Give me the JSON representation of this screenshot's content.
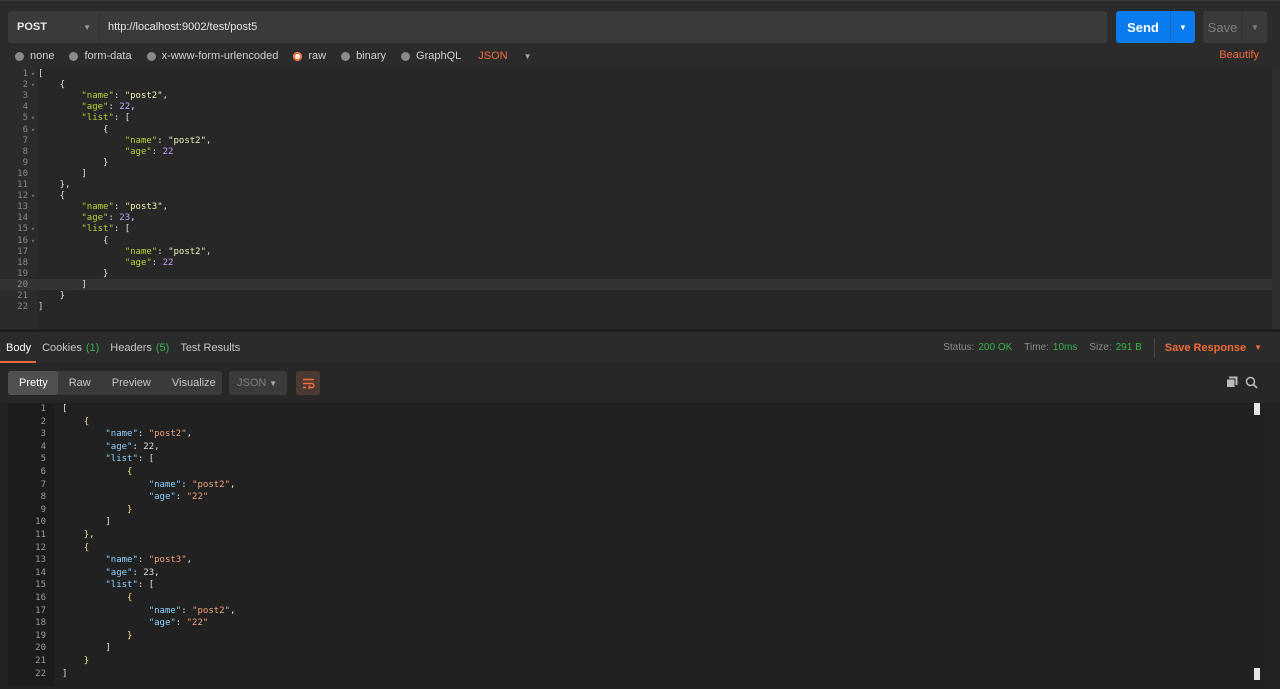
{
  "request": {
    "method": "POST",
    "url": "http://localhost:9002/test/post5",
    "send_label": "Send",
    "save_label": "Save"
  },
  "body_options": {
    "items": [
      {
        "label": "none",
        "selected": false
      },
      {
        "label": "form-data",
        "selected": false
      },
      {
        "label": "x-www-form-urlencoded",
        "selected": false
      },
      {
        "label": "raw",
        "selected": true
      },
      {
        "label": "binary",
        "selected": false
      },
      {
        "label": "GraphQL",
        "selected": false
      }
    ],
    "format": "JSON",
    "beautify": "Beautify"
  },
  "request_body": [
    {
      "n": "1",
      "fold": true,
      "t": "["
    },
    {
      "n": "2",
      "fold": true,
      "t": "    {"
    },
    {
      "n": "3",
      "fold": false,
      "t": "        \"name\": \"post2\","
    },
    {
      "n": "4",
      "fold": false,
      "t": "        \"age\": 22,"
    },
    {
      "n": "5",
      "fold": true,
      "t": "        \"list\": ["
    },
    {
      "n": "6",
      "fold": true,
      "t": "            {"
    },
    {
      "n": "7",
      "fold": false,
      "t": "                \"name\": \"post2\","
    },
    {
      "n": "8",
      "fold": false,
      "t": "                \"age\": 22"
    },
    {
      "n": "9",
      "fold": false,
      "t": "            }"
    },
    {
      "n": "10",
      "fold": false,
      "t": "        ]"
    },
    {
      "n": "11",
      "fold": false,
      "t": "    },"
    },
    {
      "n": "12",
      "fold": true,
      "t": "    {"
    },
    {
      "n": "13",
      "fold": false,
      "t": "        \"name\": \"post3\","
    },
    {
      "n": "14",
      "fold": false,
      "t": "        \"age\": 23,"
    },
    {
      "n": "15",
      "fold": true,
      "t": "        \"list\": ["
    },
    {
      "n": "16",
      "fold": true,
      "t": "            {"
    },
    {
      "n": "17",
      "fold": false,
      "t": "                \"name\": \"post2\","
    },
    {
      "n": "18",
      "fold": false,
      "t": "                \"age\": 22"
    },
    {
      "n": "19",
      "fold": false,
      "t": "            }"
    },
    {
      "n": "20",
      "fold": false,
      "t": "        ]"
    },
    {
      "n": "21",
      "fold": false,
      "t": "    }"
    },
    {
      "n": "22",
      "fold": false,
      "t": "]"
    }
  ],
  "response": {
    "tabs": [
      {
        "label": "Body",
        "count": ""
      },
      {
        "label": "Cookies",
        "count": "(1)"
      },
      {
        "label": "Headers",
        "count": "(5)"
      },
      {
        "label": "Test Results",
        "count": ""
      }
    ],
    "status_label": "Status:",
    "status_value": "200 OK",
    "time_label": "Time:",
    "time_value": "10ms",
    "size_label": "Size:",
    "size_value": "291 B",
    "save_response": "Save Response",
    "views": [
      "Pretty",
      "Raw",
      "Preview",
      "Visualize"
    ],
    "format": "JSON"
  },
  "response_body": [
    {
      "n": "1",
      "t": "["
    },
    {
      "n": "2",
      "t": "    {"
    },
    {
      "n": "3",
      "t": "        \"name\": \"post2\","
    },
    {
      "n": "4",
      "t": "        \"age\": 22,"
    },
    {
      "n": "5",
      "t": "        \"list\": ["
    },
    {
      "n": "6",
      "t": "            {"
    },
    {
      "n": "7",
      "t": "                \"name\": \"post2\","
    },
    {
      "n": "8",
      "t": "                \"age\": \"22\""
    },
    {
      "n": "9",
      "t": "            }"
    },
    {
      "n": "10",
      "t": "        ]"
    },
    {
      "n": "11",
      "t": "    },"
    },
    {
      "n": "12",
      "t": "    {"
    },
    {
      "n": "13",
      "t": "        \"name\": \"post3\","
    },
    {
      "n": "14",
      "t": "        \"age\": 23,"
    },
    {
      "n": "15",
      "t": "        \"list\": ["
    },
    {
      "n": "16",
      "t": "            {"
    },
    {
      "n": "17",
      "t": "                \"name\": \"post2\","
    },
    {
      "n": "18",
      "t": "                \"age\": \"22\""
    },
    {
      "n": "19",
      "t": "            }"
    },
    {
      "n": "20",
      "t": "        ]"
    },
    {
      "n": "21",
      "t": "    }"
    },
    {
      "n": "22",
      "t": "]"
    }
  ],
  "colors": {
    "accent": "#f26b3a",
    "send": "#097bed",
    "success": "#34b34a"
  },
  "icons": {
    "wrap": "wrap-lines-icon",
    "copy": "copy-icon",
    "search": "search-icon"
  }
}
